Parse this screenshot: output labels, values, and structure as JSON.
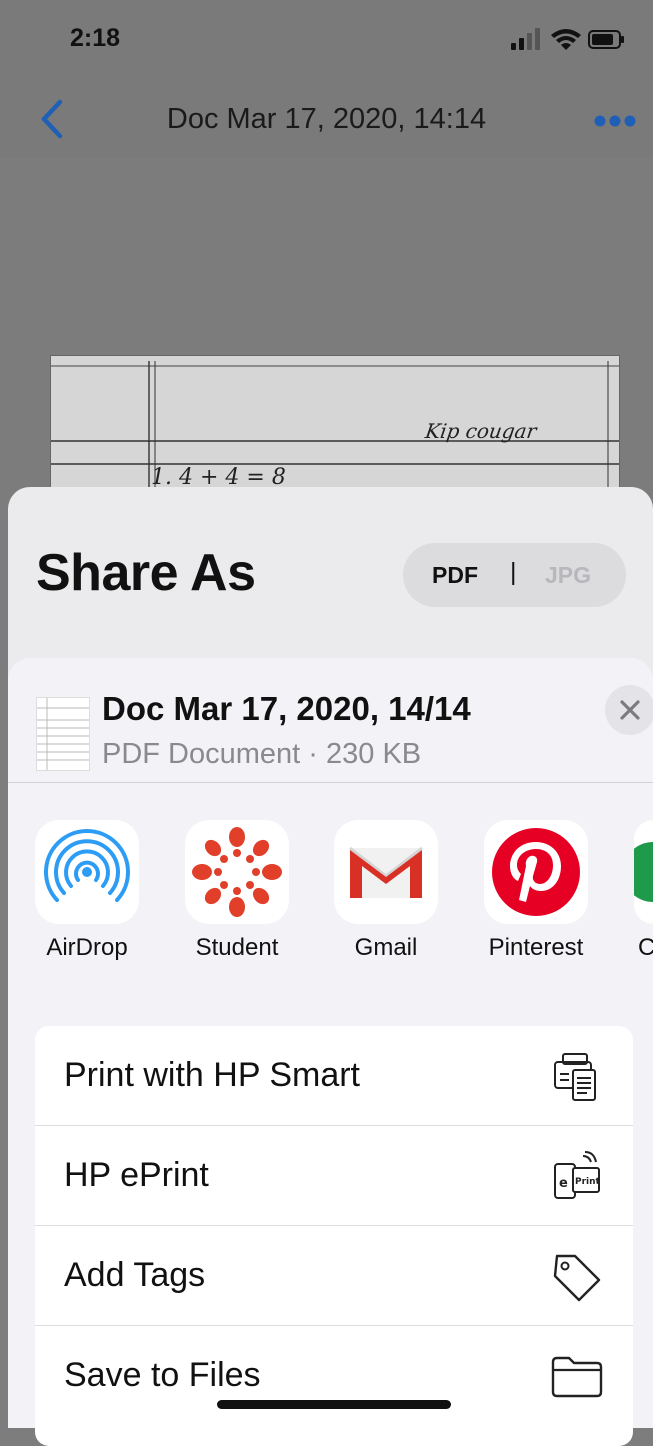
{
  "status_bar": {
    "time": "2:18"
  },
  "nav": {
    "title": "Doc Mar 17, 2020, 14:14"
  },
  "document_preview": {
    "handwriting_top": "Kip cougar",
    "handwriting_line": "1. 4 + 4 = 8"
  },
  "share_as": {
    "title": "Share As",
    "format_options": [
      "PDF",
      "JPG"
    ],
    "separator": "|",
    "selected_format": "PDF"
  },
  "file": {
    "name": "Doc Mar 17, 2020, 14/14",
    "details": "PDF Document · 230 KB"
  },
  "apps": [
    {
      "label": "AirDrop",
      "icon": "airdrop-icon"
    },
    {
      "label": "Student",
      "icon": "canvas-student-icon"
    },
    {
      "label": "Gmail",
      "icon": "gmail-icon"
    },
    {
      "label": "Pinterest",
      "icon": "pinterest-icon"
    },
    {
      "label": "C",
      "icon": "partial-app-icon"
    }
  ],
  "actions": [
    {
      "label": "Print with HP Smart",
      "icon": "printer-icon"
    },
    {
      "label": "HP ePrint",
      "icon": "eprint-icon"
    },
    {
      "label": "Add Tags",
      "icon": "tag-icon"
    },
    {
      "label": "Save to Files",
      "icon": "folder-icon"
    }
  ],
  "colors": {
    "accent_blue": "#1f5fb5",
    "gmail_red": "#d93025",
    "pinterest_red": "#e60023",
    "canvas_red": "#e13f2a",
    "airdrop_blue": "#2d9cf5"
  }
}
